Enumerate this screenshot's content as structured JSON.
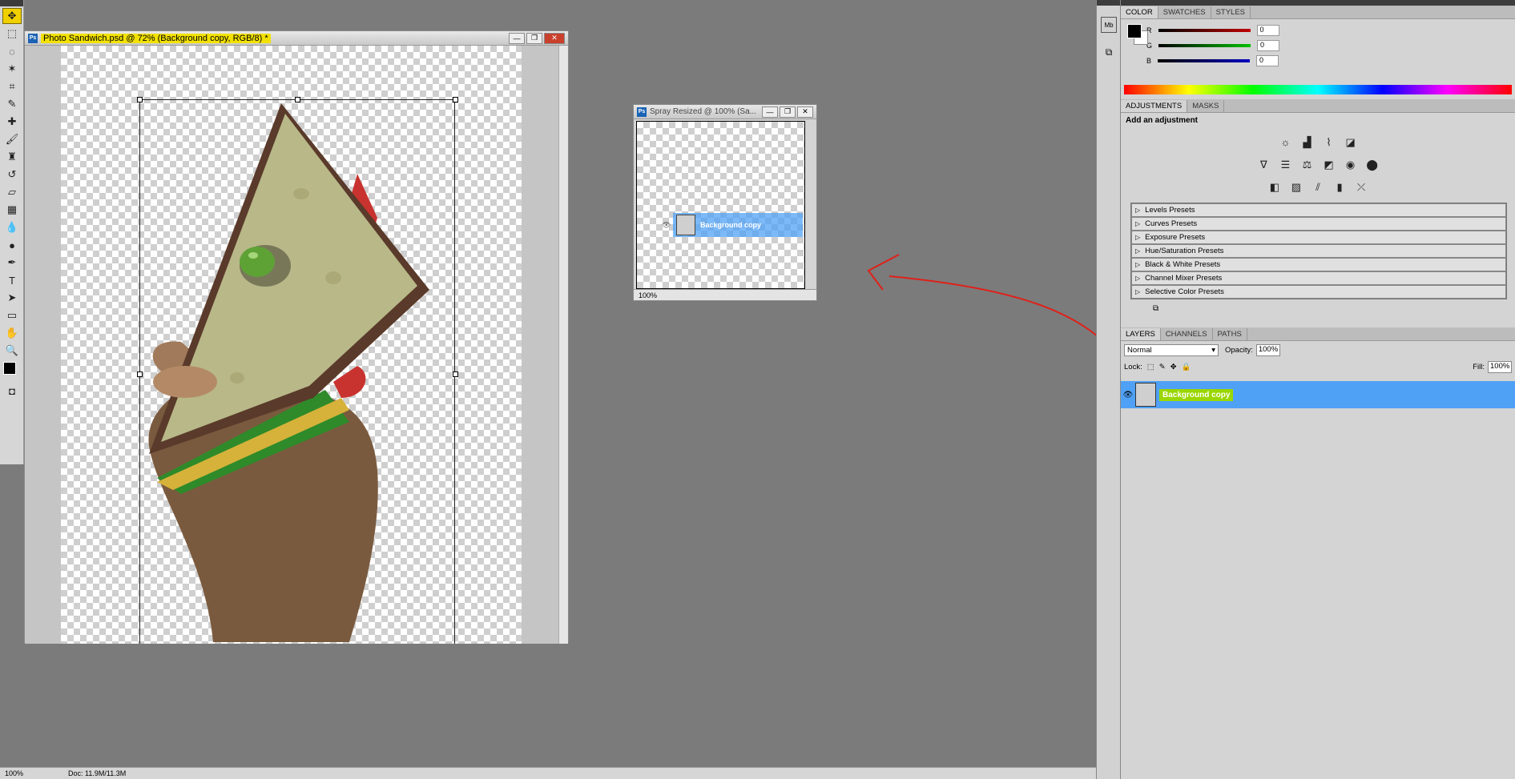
{
  "toolbar": {
    "tools": [
      "move-tool",
      "marquee-tool",
      "lasso-tool",
      "magic-wand-tool",
      "crop-tool",
      "eyedropper-tool",
      "healing-brush-tool",
      "brush-tool",
      "clone-stamp-tool",
      "history-brush-tool",
      "eraser-tool",
      "gradient-tool",
      "blur-tool",
      "dodge-tool",
      "pen-tool",
      "type-tool",
      "path-selection-tool",
      "shape-tool",
      "hand-tool",
      "zoom-tool"
    ]
  },
  "main_doc": {
    "title": "Photo Sandwich.psd @ 72% (Background copy, RGB/8) *",
    "zoom": "100%",
    "doc_info": "Doc: 11.9M/11.3M"
  },
  "spray_doc": {
    "title": "Spray Resized @ 100% (Sa...",
    "zoom": "100%",
    "layer_label": "Background copy"
  },
  "color_panel": {
    "tabs": [
      "COLOR",
      "SWATCHES",
      "STYLES"
    ],
    "channels": [
      {
        "label": "R",
        "value": "0",
        "color": "#c00000"
      },
      {
        "label": "G",
        "value": "0",
        "color": "#00a000"
      },
      {
        "label": "B",
        "value": "0",
        "color": "#0000c0"
      }
    ]
  },
  "adjustments_panel": {
    "tabs": [
      "ADJUSTMENTS",
      "MASKS"
    ],
    "heading": "Add an adjustment",
    "presets": [
      "Levels Presets",
      "Curves Presets",
      "Exposure Presets",
      "Hue/Saturation Presets",
      "Black & White Presets",
      "Channel Mixer Presets",
      "Selective Color Presets"
    ]
  },
  "layers_panel": {
    "tabs": [
      "LAYERS",
      "CHANNELS",
      "PATHS"
    ],
    "blend_mode": "Normal",
    "opacity_label": "Opacity:",
    "opacity_value": "100%",
    "lock_label": "Lock:",
    "fill_label": "Fill:",
    "fill_value": "100%",
    "layers": [
      {
        "name": "Background copy",
        "visible": true,
        "selected": true
      }
    ]
  },
  "colors": {
    "highlight": "#f2e100",
    "selection": "#4fa1f6",
    "annotation": "#e0201a"
  }
}
